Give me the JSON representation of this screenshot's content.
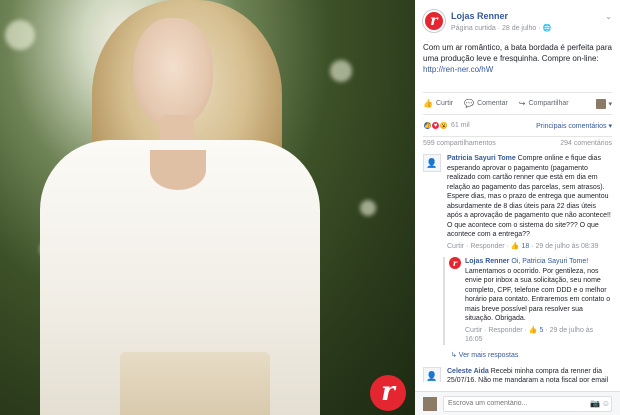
{
  "photo": {
    "badge_letter": "r"
  },
  "post": {
    "close_glyph": "✕",
    "page_name": "Lojas Renner",
    "page_meta": "Página curtida · 28 de julho · 🌐",
    "page_avatar_letter": "r",
    "text": "Com um ar romântico, a bata bordada é perfeita para uma produção leve e fresquinha. Compre on-line: ",
    "link": "http://ren-ner.co/hW",
    "actions": {
      "like": "Curtir",
      "comment": "Comentar",
      "share": "Compartilhar"
    },
    "reaction_count": "61 mil",
    "top_comments": "Principais comentários ▾",
    "shares": "599 compartilhamentos",
    "comments_count": "294 comentários",
    "comments": [
      {
        "author": "Patricia Sayuri Tome",
        "text": " Compre online e fique dias esperando aprovar o pagamento (pagamento realizado com cartão renner que está em dia em relação ao pagamento das parcelas, sem atrasos). Espere dias, mas o prazo de entrega que aumentou absurdamente de 8 dias úteis para 22 dias úteis após a aprovação de pagamento que não acontece!! O que acontece com o sistema do site??? O que acontece com a entrega??",
        "meta_actions": "Curtir · Responder · ",
        "likes": "👍 18",
        "date": " · 29 de julho às 08:39",
        "reply": {
          "author": "Lojas Renner",
          "mention": "Oi, Patricia Sayuri Tome!",
          "text": " Lamentamos o ocorrido. Por gentileza, nos envie por inbox a sua solicitação, seu nome completo, CPF, telefone com DDD e o melhor horário para contato. Entraremos em contato o mais breve possível para resolver sua situação. Obrigada.",
          "meta_actions": "Curtir · Responder · ",
          "likes": "👍 5",
          "date": " · 29 de julho às 16:05"
        },
        "more_replies": "↳ Ver mais respostas"
      },
      {
        "author": "Celeste Aida",
        "text": " Recebi minha compra da renner dia 25/07/16. Não me mandaram a nota fiscal por email como sempre fazem e a entrega que foi feito"
      }
    ],
    "write_placeholder": "Escrova um comentário..."
  }
}
